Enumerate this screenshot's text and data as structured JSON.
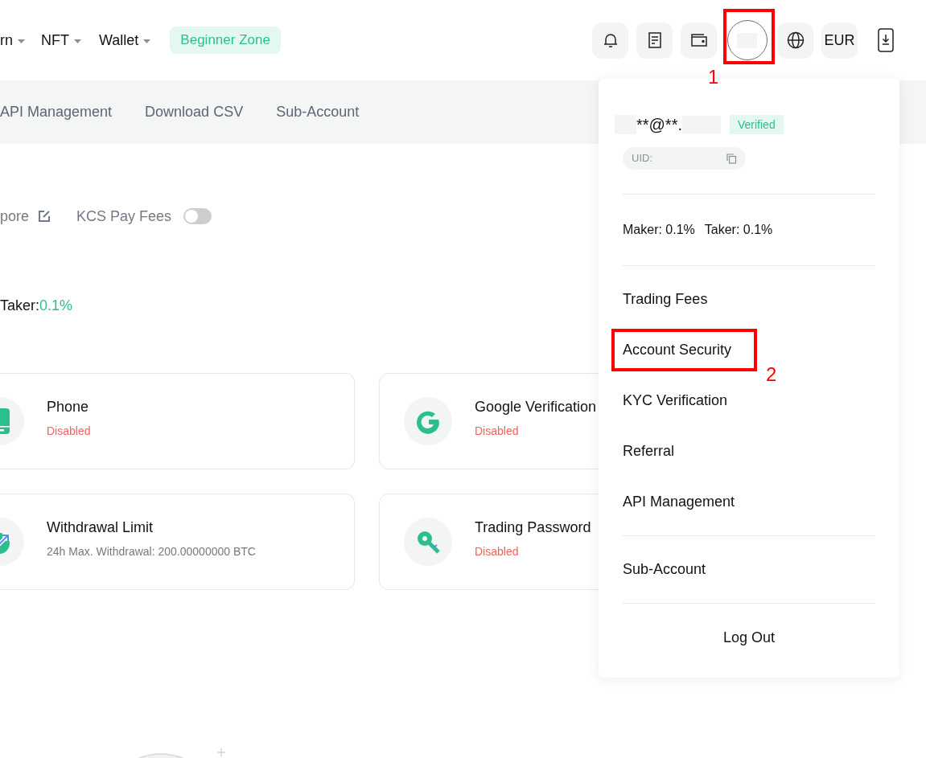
{
  "header": {
    "nav": [
      {
        "label": "rn",
        "dropdown": true
      },
      {
        "label": "NFT",
        "dropdown": true
      },
      {
        "label": "Wallet",
        "dropdown": true
      }
    ],
    "beginner_zone": "Beginner Zone",
    "currency": "EUR",
    "avatar_annotation": "1"
  },
  "subnav": [
    "API Management",
    "Download CSV",
    "Sub-Account"
  ],
  "settings": {
    "link_text": "pore",
    "kcs_pay_fees": {
      "label": "KCS Pay Fees",
      "on": false
    }
  },
  "fees": {
    "label": "Taker:",
    "value": "0.1%"
  },
  "cards": [
    {
      "kind": "phone",
      "title": "Phone",
      "subtitle": "Disabled",
      "warning": true
    },
    {
      "kind": "google",
      "title": "Google Verification",
      "subtitle": "Disabled",
      "warning": true
    },
    {
      "kind": "withdrawal",
      "title": "Withdrawal Limit",
      "subtitle": "24h Max. Withdrawal: 200.00000000 BTC",
      "warning": false
    },
    {
      "kind": "key",
      "title": "Trading Password",
      "subtitle": "Disabled",
      "warning": true
    }
  ],
  "dropdown": {
    "email": "**@**.",
    "badge": "Verified",
    "uid_label": "UID:",
    "maker": "Maker: 0.1%",
    "taker": "Taker: 0.1%",
    "groups": [
      [
        {
          "label": "Trading Fees",
          "highlighted": false
        },
        {
          "label": "Account Security",
          "highlighted": true,
          "annotation": "2"
        },
        {
          "label": "KYC Verification",
          "highlighted": false
        },
        {
          "label": "Referral",
          "highlighted": false
        },
        {
          "label": "API Management",
          "highlighted": false
        }
      ],
      [
        {
          "label": "Sub-Account",
          "highlighted": false
        }
      ]
    ],
    "logout": "Log Out"
  }
}
